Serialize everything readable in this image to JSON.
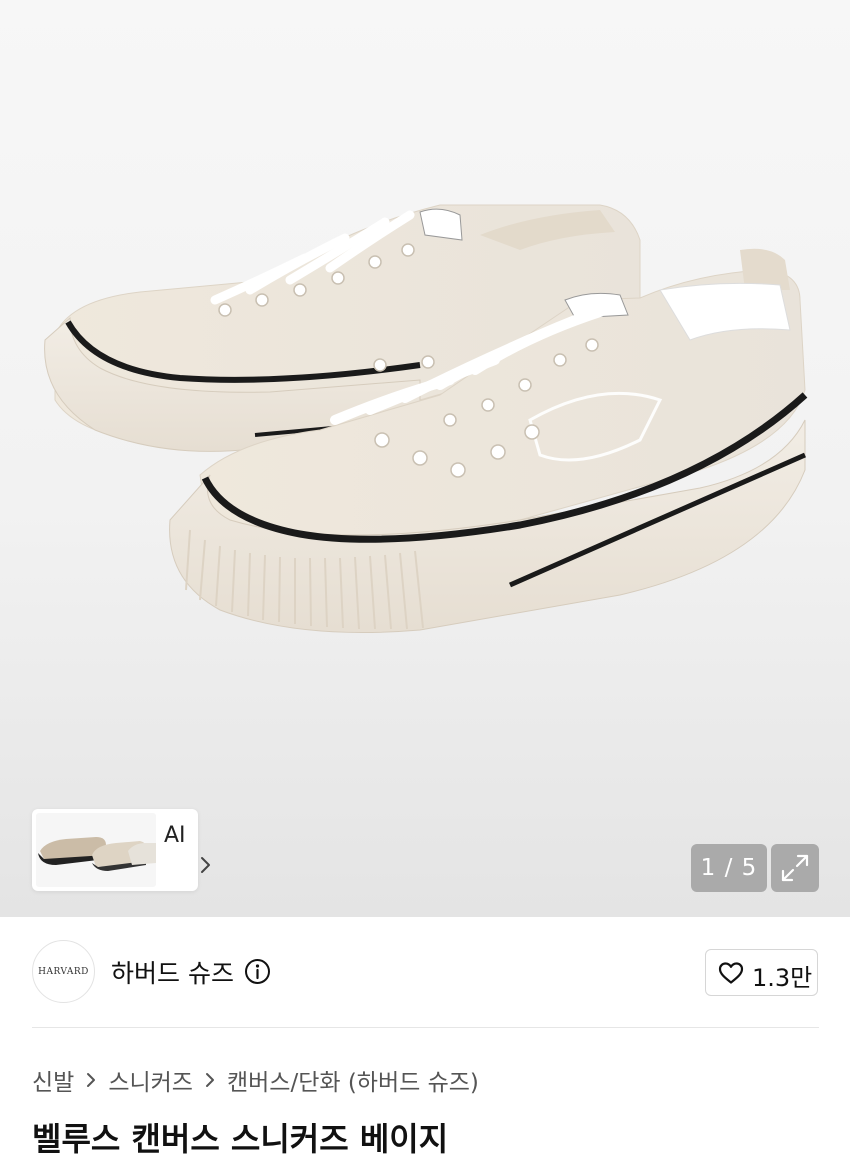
{
  "product": {
    "image_counter": "1 / 5",
    "ai_label": "AI",
    "title": "벨루스 캔버스 스니커즈 베이지"
  },
  "brand": {
    "logo_text": "HARVARD",
    "name": "하버드 슈즈",
    "likes": "1.3만"
  },
  "breadcrumb": [
    "신발",
    "스니커즈",
    "캔버스/단화 (하버드 슈즈)"
  ],
  "icons": {
    "info": "info-icon",
    "heart": "heart-icon",
    "expand": "expand-icon",
    "chevron": "chevron-right-icon"
  },
  "colors": {
    "shoe_canvas": "#efe9df",
    "sole_stripe": "#1a1a1a",
    "counter_bg": "#969696"
  }
}
